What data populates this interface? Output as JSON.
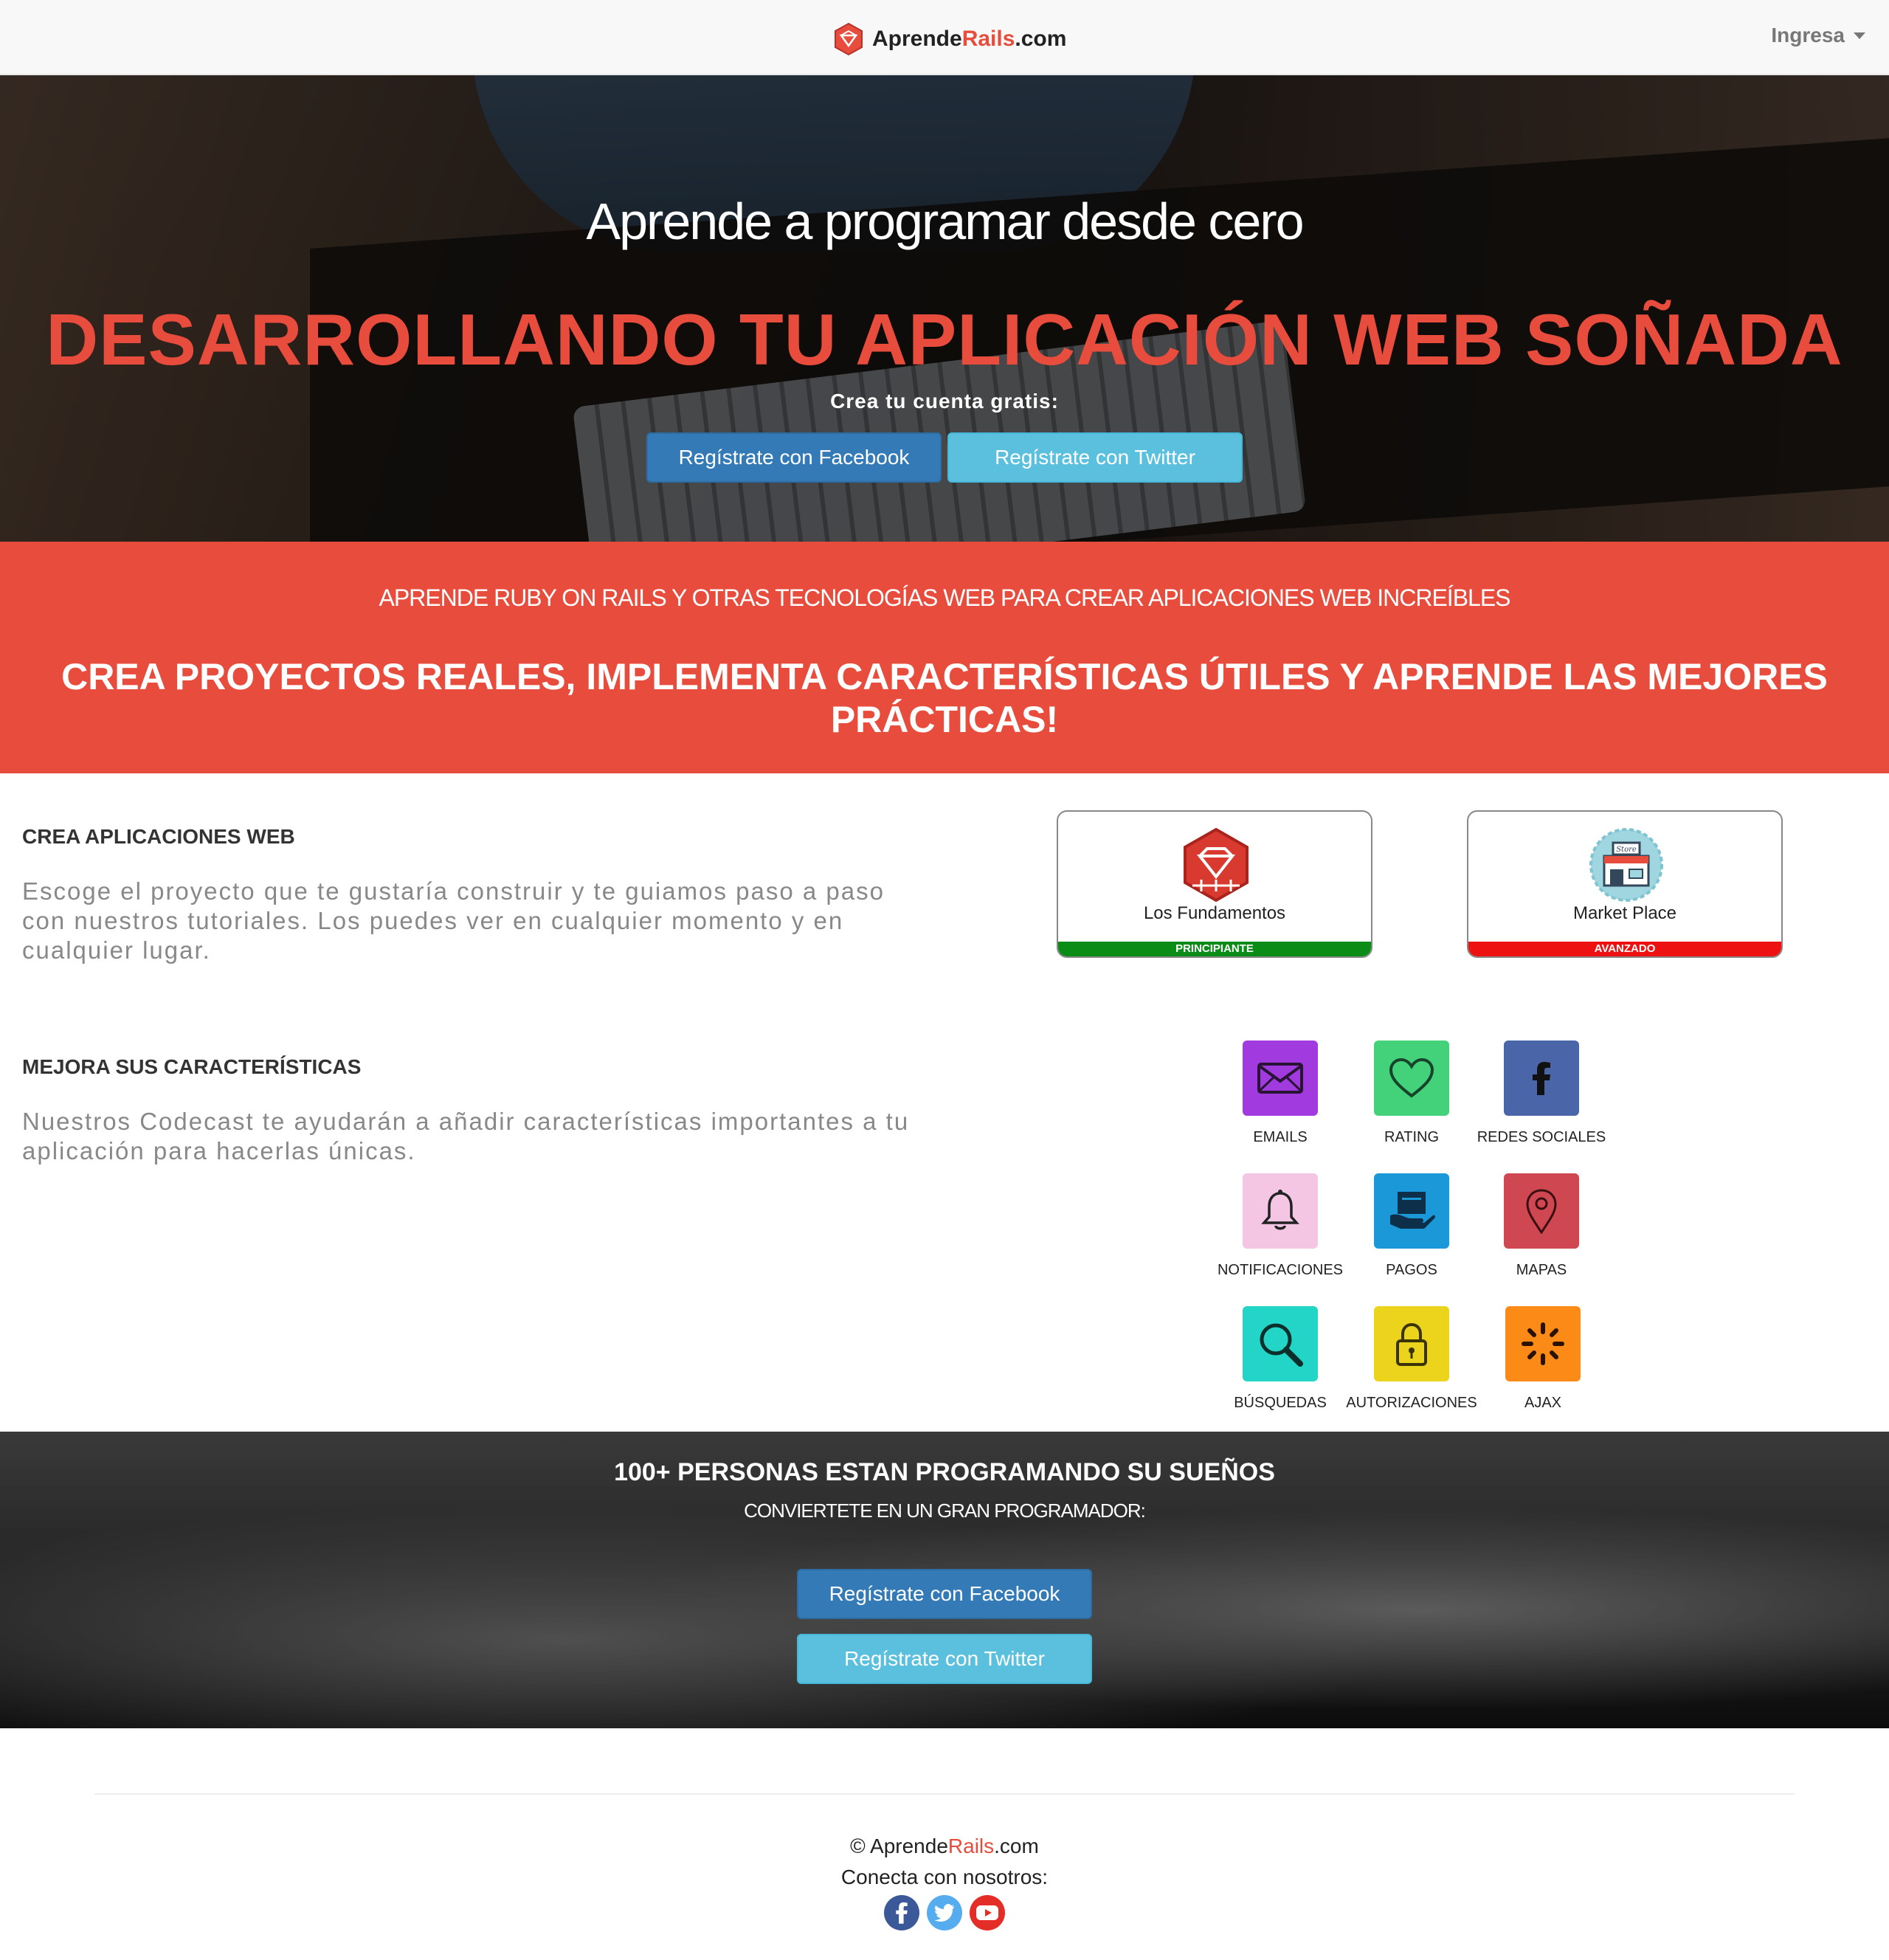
{
  "navbar": {
    "brand_prefix": "Aprende",
    "brand_accent": "Rails",
    "brand_suffix": ".com",
    "login_label": "Ingresa"
  },
  "hero": {
    "subtitle": "Aprende a programar desde cero",
    "title": "DESARROLLANDO TU APLICACIÓN WEB SOÑADA",
    "cta_label": "Crea tu cuenta gratis:",
    "facebook_button": "Regístrate con Facebook",
    "twitter_button": "Regístrate con Twitter"
  },
  "band": {
    "subtitle": "APRENDE RUBY ON RAILS Y OTRAS TECNOLOGÍAS WEB PARA CREAR APLICACIONES WEB INCREÍBLES",
    "title": "CREA PROYECTOS REALES, IMPLEMENTA CARACTERÍSTICAS ÚTILES Y APRENDE LAS MEJORES PRÁCTICAS!"
  },
  "apps_section": {
    "title": "CREA APLICACIONES WEB",
    "text": "Escoge el proyecto que te gustaría construir y te guiamos paso a paso con nuestros tutoriales. Los puedes ver en cualquier momento y en cualquier lugar.",
    "courses": [
      {
        "name": "Los Fundamentos",
        "level": "PRINCIPIANTE",
        "level_color": "#0b8c16",
        "icon": "ruby-gem-icon"
      },
      {
        "name": "Market Place",
        "level": "AVANZADO",
        "level_color": "#ee1111",
        "icon": "store-icon"
      }
    ]
  },
  "features_section": {
    "title": "MEJORA SUS CARACTERÍSTICAS",
    "text": "Nuestros Codecast te ayudarán a añadir características importantes a tu aplicación para hacerlas únicas.",
    "features": [
      {
        "label": "EMAILS",
        "color": "#a13be0",
        "icon": "envelope-icon"
      },
      {
        "label": "RATING",
        "color": "#43d17a",
        "icon": "heart-icon"
      },
      {
        "label": "REDES SOCIALES",
        "color": "#4b66a8",
        "icon": "facebook-icon"
      },
      {
        "label": "NOTIFICACIONES",
        "color": "#f4c6e3",
        "icon": "bell-icon"
      },
      {
        "label": "PAGOS",
        "color": "#1b98d8",
        "icon": "payment-icon"
      },
      {
        "label": "MAPAS",
        "color": "#cf4750",
        "icon": "map-pin-icon"
      },
      {
        "label": "BÚSQUEDAS",
        "color": "#22d5c6",
        "icon": "magnifier-icon"
      },
      {
        "label": "AUTORIZACIONES",
        "color": "#ebd41b",
        "icon": "lock-icon"
      },
      {
        "label": "AJAX",
        "color": "#fb8b16",
        "icon": "spinner-icon"
      }
    ]
  },
  "community": {
    "title": "100+ PERSONAS ESTAN PROGRAMANDO SU SUEÑOS",
    "subtitle": "CONVIERTETE EN UN GRAN PROGRAMADOR:",
    "facebook_button": "Regístrate con Facebook",
    "twitter_button": "Regístrate con Twitter"
  },
  "footer": {
    "copyright_prefix": "© Aprende",
    "copyright_accent": "Rails",
    "copyright_suffix": ".com",
    "connect": "Conecta con nosotros:",
    "social": [
      {
        "name": "facebook",
        "color": "#3b5998",
        "icon": "facebook-icon"
      },
      {
        "name": "twitter",
        "color": "#55acee",
        "icon": "twitter-icon"
      },
      {
        "name": "youtube",
        "color": "#e52d27",
        "icon": "youtube-icon"
      }
    ]
  }
}
